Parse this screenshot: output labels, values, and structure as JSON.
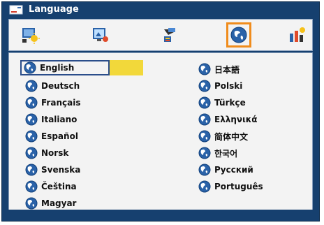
{
  "window": {
    "title": "Language",
    "title_icon": "language-menu-icon"
  },
  "tabs": [
    {
      "icon": "picture-settings-icon",
      "selected": false
    },
    {
      "icon": "display-settings-icon",
      "selected": false
    },
    {
      "icon": "setup-icon",
      "selected": false
    },
    {
      "icon": "language-globe-icon",
      "selected": true
    },
    {
      "icon": "information-icon",
      "selected": false
    }
  ],
  "languages": {
    "left": [
      "English",
      "Deutsch",
      "Français",
      "Italiano",
      "Español",
      "Norsk",
      "Svenska",
      "Čeština",
      "Magyar"
    ],
    "right": [
      "日本語",
      "Polski",
      "Türkçe",
      "Ελληνικά",
      "简体中文",
      "한국어",
      "Русский",
      "Português"
    ]
  },
  "selected_language": "English",
  "colors": {
    "frame": "#16406f",
    "panel": "#f3f3f3",
    "highlight": "#f2d83a",
    "tab_selected": "#f08c1c"
  }
}
